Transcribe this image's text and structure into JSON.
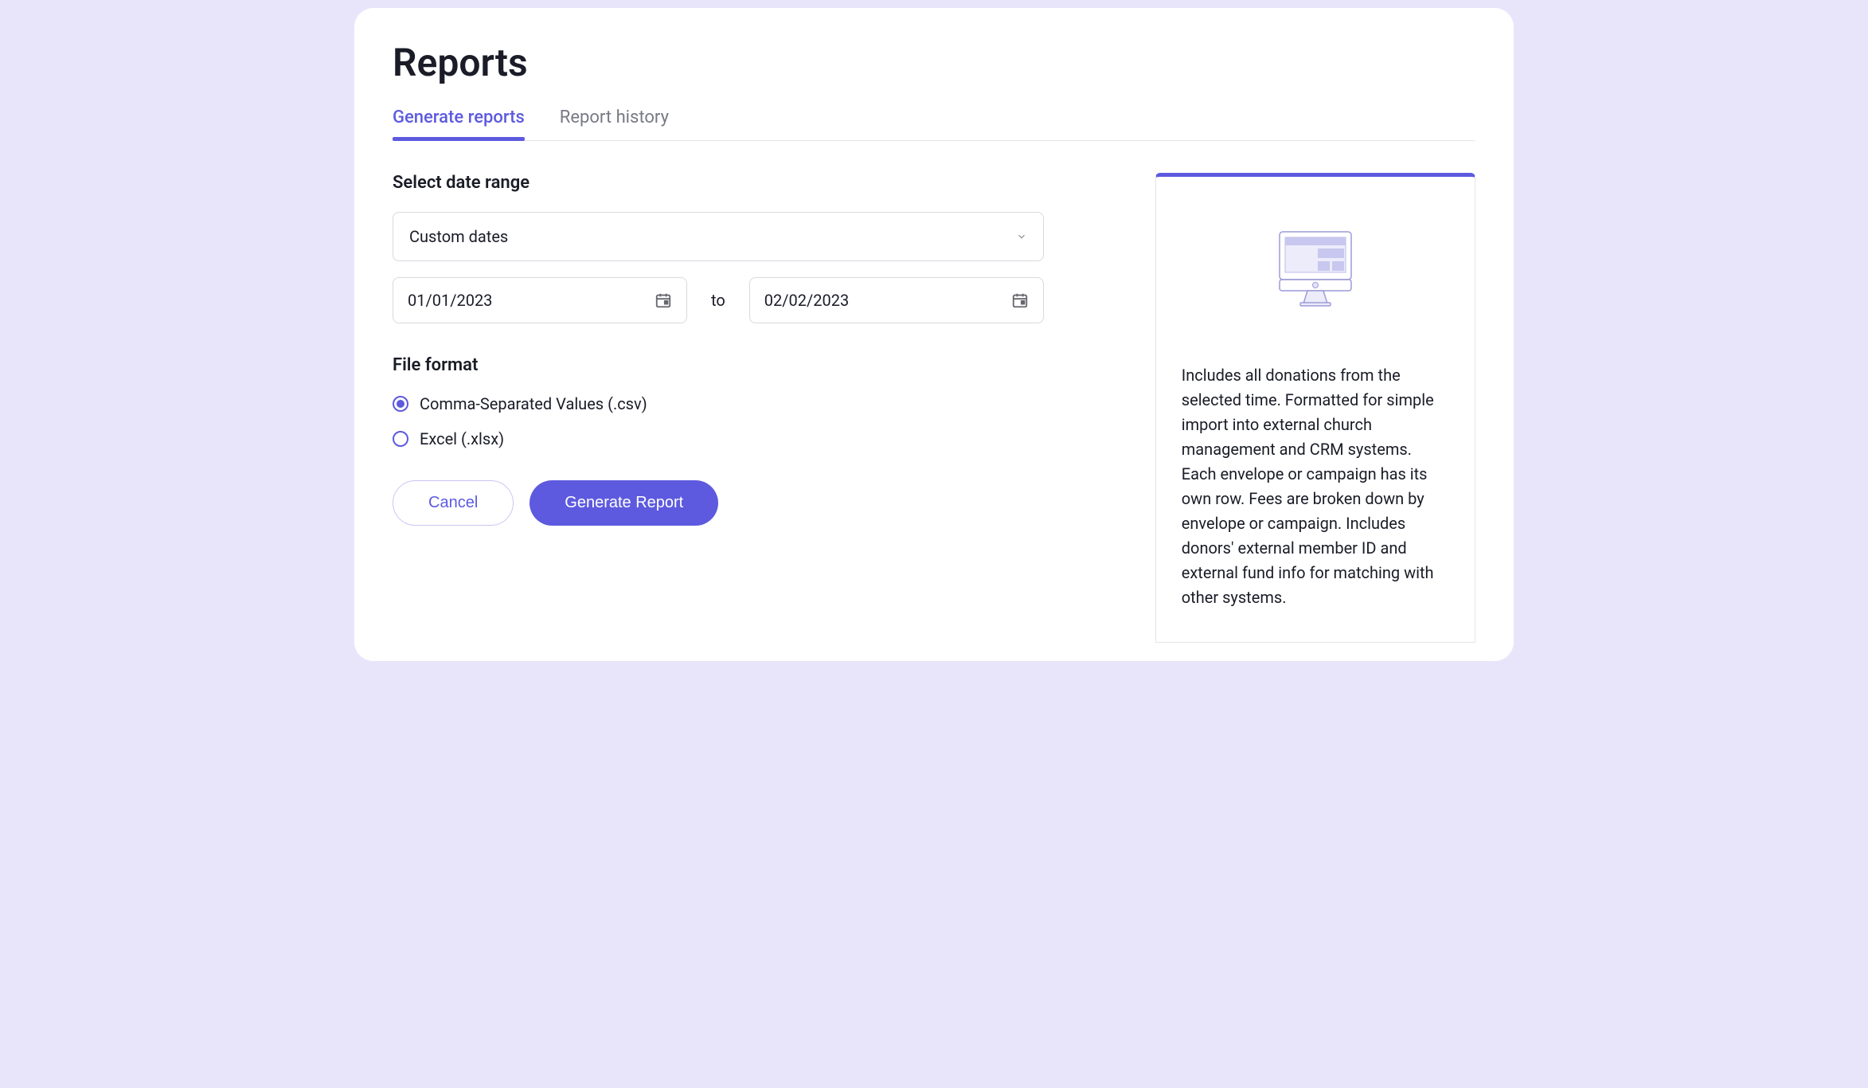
{
  "page": {
    "title": "Reports"
  },
  "tabs": {
    "generate": "Generate reports",
    "history": "Report history"
  },
  "form": {
    "date_range_heading": "Select date range",
    "range_preset": "Custom dates",
    "start_date": "01/01/2023",
    "to_label": "to",
    "end_date": "02/02/2023",
    "file_format_heading": "File format",
    "csv_label": "Comma-Separated Values (.csv)",
    "xlsx_label": "Excel (.xlsx)",
    "cancel_label": "Cancel",
    "generate_label": "Generate Report"
  },
  "info": {
    "description": "Includes all donations from the selected time. Formatted for simple import into external church management and CRM systems. Each envelope or campaign has its own row. Fees are broken down by envelope or campaign. Includes donors' external member ID and external fund info for matching with other systems."
  }
}
